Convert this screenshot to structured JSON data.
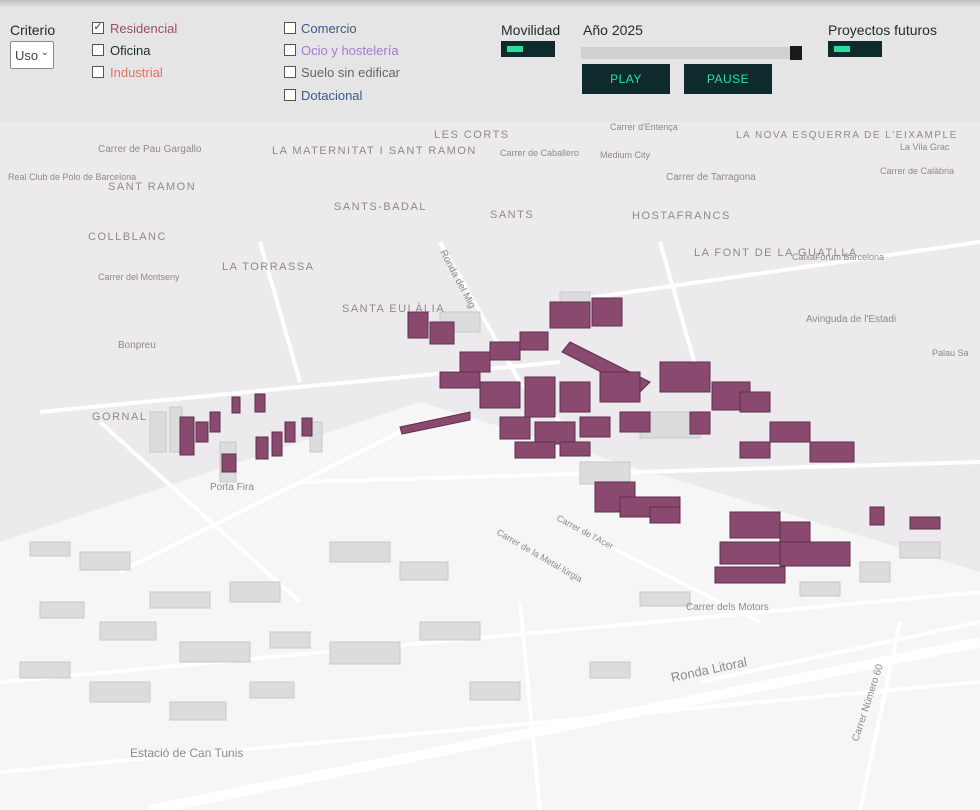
{
  "filters": {
    "criterio_label": "Criterio",
    "criterio_value": "Uso",
    "options": [
      {
        "label": "Residencial",
        "checked": true,
        "color": "#9a4a6e"
      },
      {
        "label": "Oficina",
        "checked": false,
        "color": "#1d2a31"
      },
      {
        "label": "Industrial",
        "checked": false,
        "color": "#e0745c"
      },
      {
        "label": "Comercio",
        "checked": false,
        "color": "#3a5a8c"
      },
      {
        "label": "Ocio y hostelería",
        "checked": false,
        "color": "#a57ad0"
      },
      {
        "label": "Suelo sin edificar",
        "checked": false,
        "color": "#666666"
      },
      {
        "label": "Dotacional",
        "checked": false,
        "color": "#3a5a8c"
      }
    ]
  },
  "movilidad": {
    "label": "Movilidad"
  },
  "year": {
    "label": "Año",
    "value": "2025"
  },
  "buttons": {
    "play": "PLAY",
    "pause": "PAUSE"
  },
  "futuros": {
    "label": "Proyectos futuros"
  },
  "map": {
    "labels": [
      "Carrer de Pau Gargallo",
      "Real Club de Polo de Barcelona",
      "SANT RAMON",
      "LA MATERNITAT I SANT RAMON",
      "LES CORTS",
      "Carrer de Caballero",
      "Medium City",
      "Carrer d'Entença",
      "LA NOVA ESQUERRA DE L'EIXAMPLE",
      "La Vila Grac",
      "Carrer de Calàbria",
      "Carrer de Tarragona",
      "HOSTAFRANCS",
      "SANTS",
      "SANTS-BADAL",
      "COLLBLANC",
      "LA TORRASSA",
      "Carrer del Montseny",
      "Ronda del Mig",
      "LA FONT DE LA GUATLLA",
      "CaixaForum Barcelona",
      "Avinguda de l'Estadi",
      "SANTA EULÀLIA",
      "Bonpreu",
      "GORNAL",
      "Porta Fira",
      "Carrer dels Motors",
      "Ronda Litoral",
      "Estació de Can Tunis",
      "Carrer Número 60",
      "Palau Sa",
      "Carrer de la Metal·lúrgia",
      "Carrer de l'Acer"
    ],
    "accent_color": "#8a4a70"
  }
}
